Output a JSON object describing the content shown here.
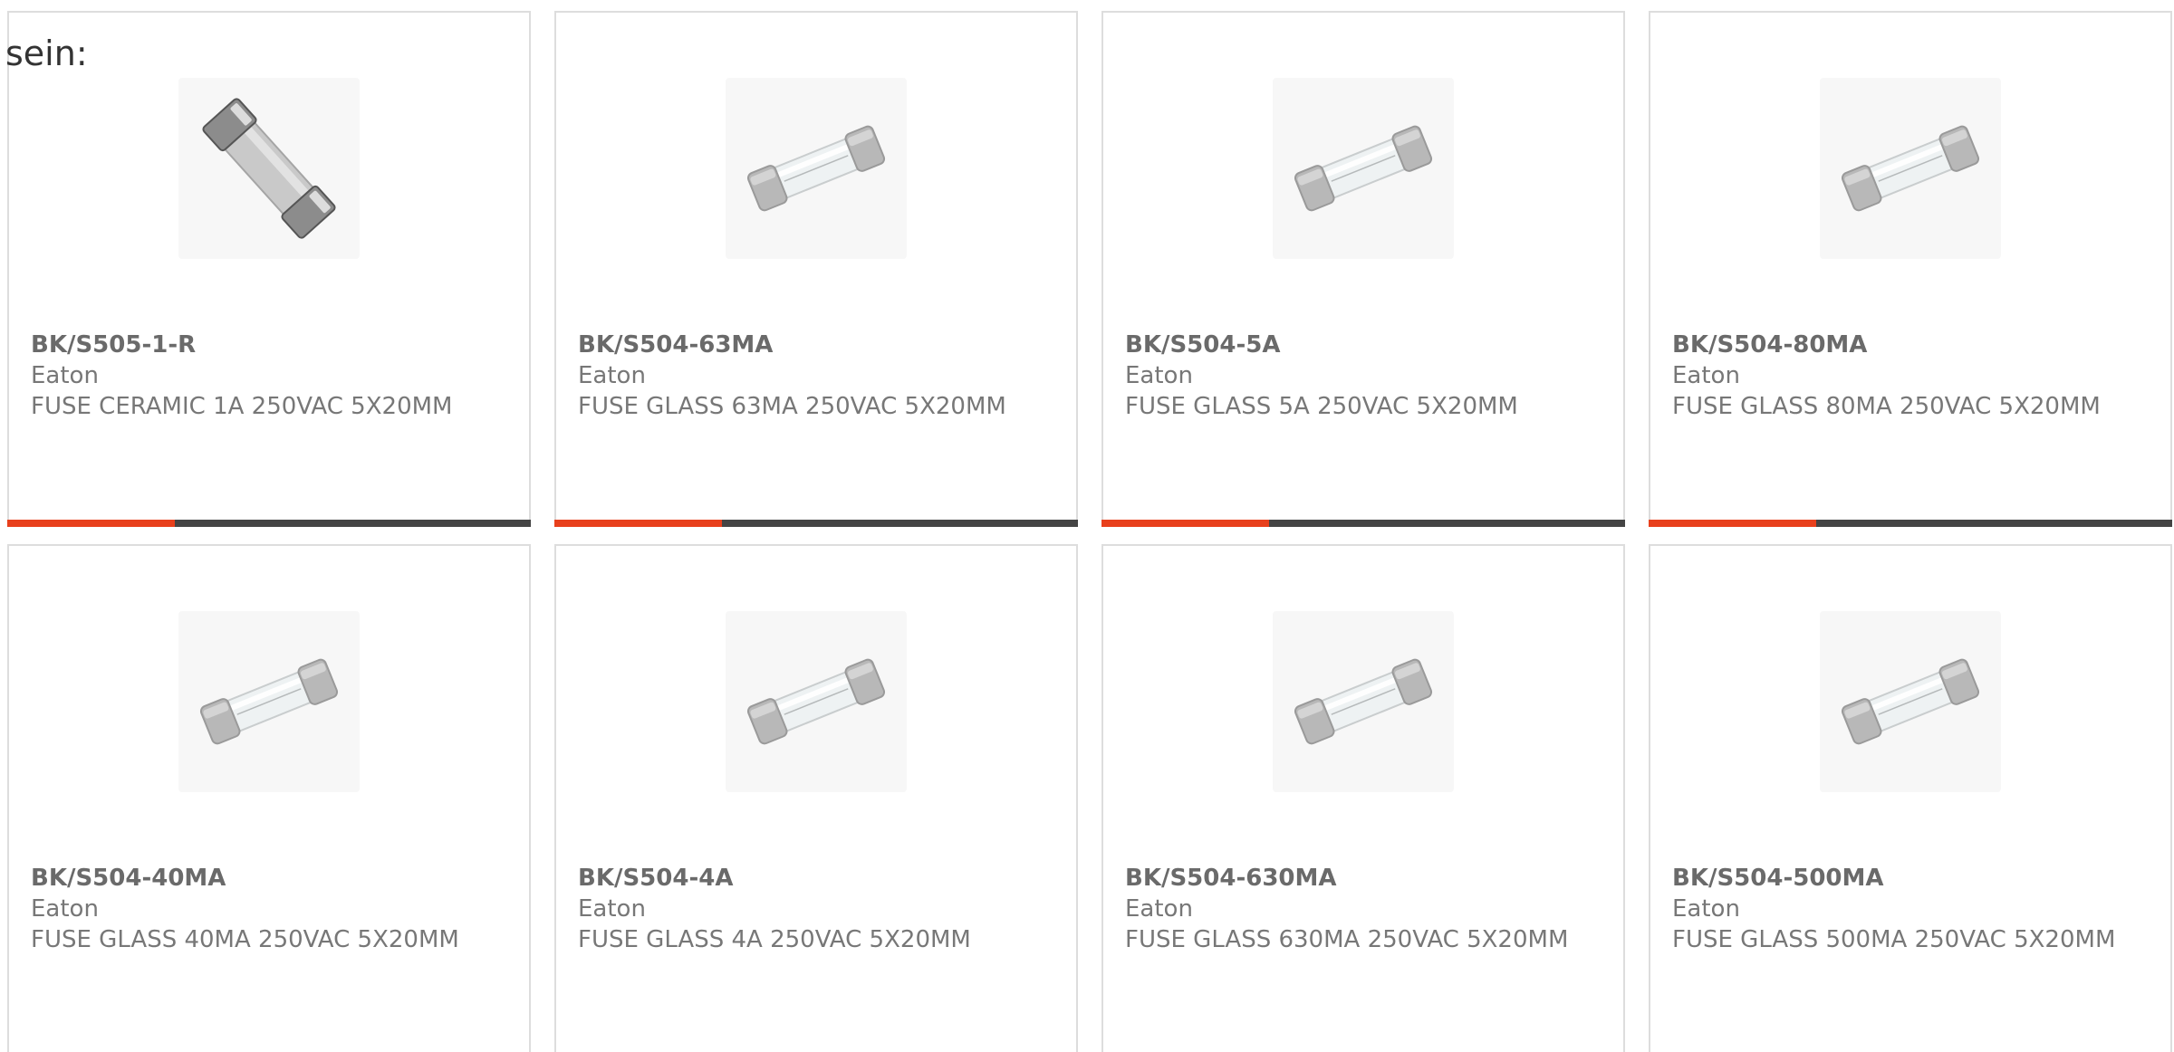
{
  "page": {
    "lead_text": "sein:"
  },
  "colors": {
    "accent": "#e8401c",
    "bar": "#444444",
    "card_border": "#dddddd",
    "text": "#777777"
  },
  "products": [
    {
      "part_number": "BK/S505-1-R",
      "manufacturer": "Eaton",
      "description": "FUSE CERAMIC 1A 250VAC 5X20MM",
      "image_icon": "ceramic-fuse-icon",
      "accent_fraction": 0.32
    },
    {
      "part_number": "BK/S504-63MA",
      "manufacturer": "Eaton",
      "description": "FUSE GLASS 63MA 250VAC 5X20MM",
      "image_icon": "glass-fuse-icon",
      "accent_fraction": 0.32
    },
    {
      "part_number": "BK/S504-5A",
      "manufacturer": "Eaton",
      "description": "FUSE GLASS 5A 250VAC 5X20MM",
      "image_icon": "glass-fuse-icon",
      "accent_fraction": 0.32
    },
    {
      "part_number": "BK/S504-80MA",
      "manufacturer": "Eaton",
      "description": "FUSE GLASS 80MA 250VAC 5X20MM",
      "image_icon": "glass-fuse-icon",
      "accent_fraction": 0.32
    },
    {
      "part_number": "BK/S504-40MA",
      "manufacturer": "Eaton",
      "description": "FUSE GLASS 40MA 250VAC 5X20MM",
      "image_icon": "glass-fuse-icon"
    },
    {
      "part_number": "BK/S504-4A",
      "manufacturer": "Eaton",
      "description": "FUSE GLASS 4A 250VAC 5X20MM",
      "image_icon": "glass-fuse-icon"
    },
    {
      "part_number": "BK/S504-630MA",
      "manufacturer": "Eaton",
      "description": "FUSE GLASS 630MA 250VAC 5X20MM",
      "image_icon": "glass-fuse-icon"
    },
    {
      "part_number": "BK/S504-500MA",
      "manufacturer": "Eaton",
      "description": "FUSE GLASS 500MA 250VAC 5X20MM",
      "image_icon": "glass-fuse-icon"
    }
  ]
}
